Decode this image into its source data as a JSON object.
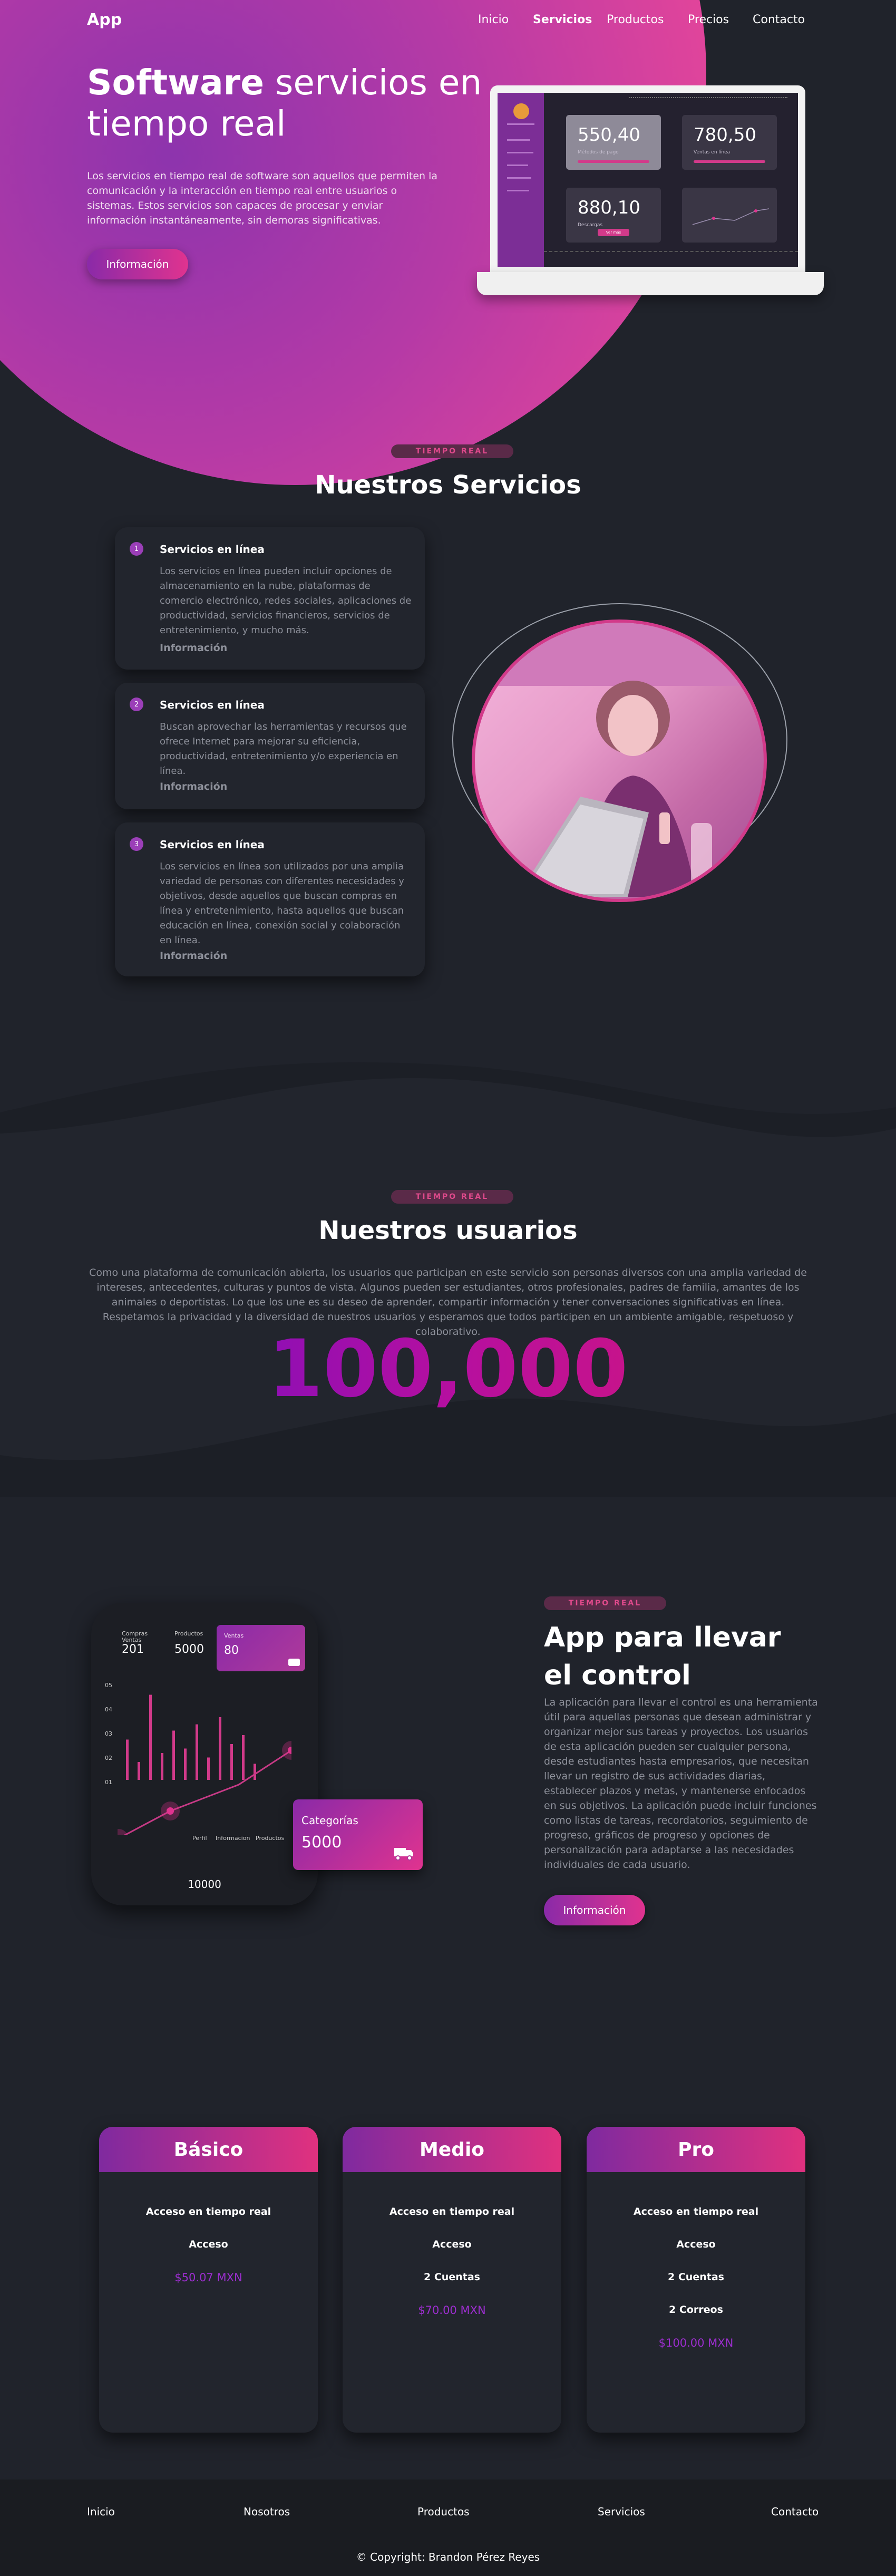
{
  "nav": {
    "logo": "App",
    "links": [
      "Inicio",
      "Servicios",
      "Productos",
      "Precios",
      "Contacto"
    ]
  },
  "hero": {
    "title_bold": "Software",
    "title_rest": " servicios en tiempo real",
    "text": "Los servicios en tiempo real de software son aquellos que permiten la comunicación y la interacción en tiempo real entre usuarios o sistemas. Estos servicios son capaces de procesar y enviar información instantáneamente, sin demoras significativas.",
    "button": "Información",
    "dashboard": {
      "values": [
        "550,40",
        "780,50",
        "880,10"
      ],
      "subs": [
        "Métodos de pago",
        "Ventas en línea",
        "Descargas"
      ],
      "button": "Ver más"
    }
  },
  "services": {
    "tag": "TIEMPO REAL",
    "title": "Nuestros Servicios",
    "items": [
      {
        "num": "1",
        "title": "Servicios en línea",
        "text": "Los servicios en línea pueden incluir opciones de almacenamiento en la nube, plataformas de comercio electrónico, redes sociales, aplicaciones de productividad, servicios financieros, servicios de entretenimiento, y mucho más.",
        "link": "Información"
      },
      {
        "num": "2",
        "title": "Servicios en línea",
        "text": "Buscan aprovechar las herramientas y recursos que ofrece Internet para mejorar su eficiencia, productividad, entretenimiento y/o experiencia en línea.",
        "link": "Información"
      },
      {
        "num": "3",
        "title": "Servicios en línea",
        "text": "Los servicios en línea son utilizados por una amplia variedad de personas con diferentes necesidades y objetivos, desde aquellos que buscan compras en línea y entretenimiento, hasta aquellos que buscan educación en línea, conexión social y colaboración en línea.",
        "link": "Información"
      }
    ]
  },
  "users": {
    "tag": "TIEMPO REAL",
    "title": "Nuestros usuarios",
    "text": "Como una plataforma de comunicación abierta, los usuarios que participan en este servicio son personas diversos con una amplia variedad de intereses, antecedentes, culturas y puntos de vista. Algunos pueden ser estudiantes, otros profesionales, padres de familia, amantes de los animales o deportistas. Lo que los une es su deseo de aprender, compartir información y tener conversaciones significativas en línea. Respetamos la privacidad y la diversidad de nuestros usuarios y esperamos que todos participen en un ambiente amigable, respetuoso y colaborativo.",
    "number": "100,000"
  },
  "control": {
    "tag": "TIEMPO REAL",
    "title": "App para llevar el control",
    "text": "La aplicación para llevar el control es una herramienta útil para aquellas personas que desean administrar y organizar mejor sus tareas y proyectos. Los usuarios de esta aplicación pueden ser cualquier persona, desde estudiantes hasta empresarios, que necesitan llevar un registro de sus actividades diarias, establecer plazos y metas, y mantenerse enfocados en sus objetivos. La aplicación puede incluir funciones como listas de tareas, recordatorios, seguimiento de progreso, gráficos de progreso y opciones de personalización para adaptarse a las necesidades individuales de cada usuario.",
    "button": "Información",
    "phone": {
      "stat1_label": "Compras",
      "stat1_sub": "Ventas",
      "stat1_value": "201",
      "stat2_label": "Productos",
      "stat2_value": "5000",
      "card_label": "Ventas",
      "card_value": "80",
      "yticks": [
        "05",
        "04",
        "03",
        "02",
        "01"
      ],
      "legend": [
        "Perfil",
        "Informacion",
        "Productos"
      ],
      "bottom": "10000",
      "bars": [
        0.45,
        0.2,
        0.95,
        0.3,
        0.55,
        0.35,
        0.62,
        0.25,
        0.7,
        0.4,
        0.5,
        0.18
      ],
      "categories_label": "Categorías",
      "categories_value": "5000"
    }
  },
  "pricing": [
    {
      "name": "Básico",
      "items": [
        "Acceso en tiempo real",
        "Acceso"
      ],
      "price": "$50.07 MXN"
    },
    {
      "name": "Medio",
      "items": [
        "Acceso en tiempo real",
        "Acceso",
        "2 Cuentas"
      ],
      "price": "$70.00 MXN"
    },
    {
      "name": "Pro",
      "items": [
        "Acceso en tiempo real",
        "Acceso",
        "2 Cuentas",
        "2 Correos"
      ],
      "price": "$100.00 MXN"
    }
  ],
  "footer": {
    "links": [
      "Inicio",
      "Nosotros",
      "Productos",
      "Servicios",
      "Contacto"
    ],
    "copyright": "© Copyright: Brandon Pérez Reyes"
  },
  "colors": {
    "accent": "#e0338f",
    "purple": "#8a2aa8",
    "bg": "#20232b",
    "muted": "#8e919b"
  }
}
